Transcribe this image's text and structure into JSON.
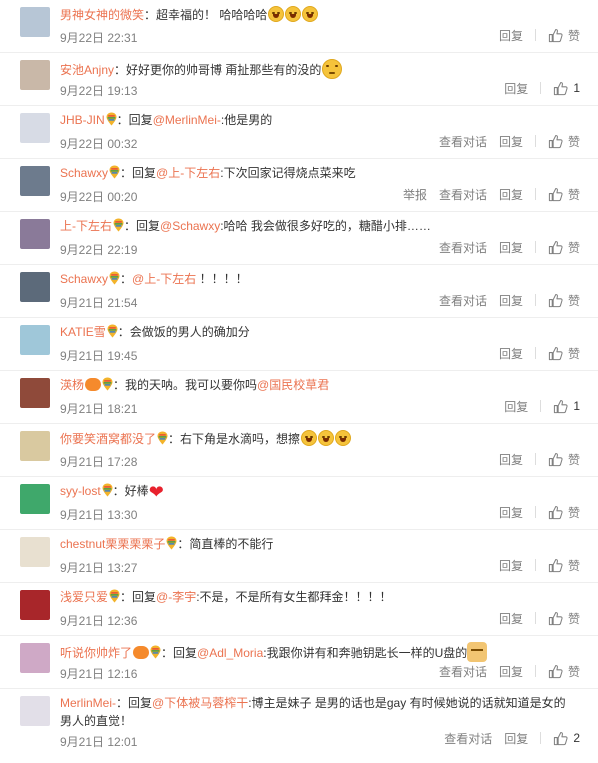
{
  "labels": {
    "reply": "回复",
    "view_dialog": "查看对话",
    "report": "举报",
    "like": "赞"
  },
  "comments": [
    {
      "user": "男神女神的微笑",
      "segments": [
        {
          "t": "：超幸福的！ 哈哈哈哈",
          "k": "txt"
        }
      ],
      "emojis": 3,
      "time": "9月22日 22:31",
      "dialog": false,
      "report": false,
      "likes": ""
    },
    {
      "user": "安池Anjny",
      "segments": [
        {
          "t": "：好好更你的帅哥博 甭扯那些有的没的",
          "k": "txt"
        }
      ],
      "emojis": 1,
      "big_emoji": true,
      "time": "9月22日 19:13",
      "dialog": false,
      "report": false,
      "likes": "1"
    },
    {
      "user": "JHB-JIN",
      "badge": true,
      "segments": [
        {
          "t": "：回复",
          "k": "txt"
        },
        {
          "t": "@MerlinMei-",
          "k": "mention"
        },
        {
          "t": ":他是男的",
          "k": "txt"
        }
      ],
      "time": "9月22日 00:32",
      "dialog": true,
      "report": false,
      "likes": ""
    },
    {
      "user": "Schawxy",
      "badge": true,
      "segments": [
        {
          "t": "：回复",
          "k": "txt"
        },
        {
          "t": "@上-下左右",
          "k": "mention"
        },
        {
          "t": ":下次回家记得烧点菜来吃",
          "k": "txt"
        }
      ],
      "time": "9月22日 00:20",
      "dialog": true,
      "report": true,
      "likes": ""
    },
    {
      "user": "上-下左右",
      "badge": true,
      "segments": [
        {
          "t": "：回复",
          "k": "txt"
        },
        {
          "t": "@Schawxy",
          "k": "mention"
        },
        {
          "t": ":哈哈  我会做很多好吃的，糖醋小排……",
          "k": "txt"
        }
      ],
      "time": "9月22日 22:19",
      "dialog": true,
      "report": false,
      "likes": ""
    },
    {
      "user": "Schawxy",
      "badge": true,
      "segments": [
        {
          "t": "：",
          "k": "txt"
        },
        {
          "t": "@上-下左右",
          "k": "mention"
        },
        {
          "t": " ！！！！",
          "k": "txt"
        }
      ],
      "time": "9月21日 21:54",
      "dialog": true,
      "report": false,
      "likes": ""
    },
    {
      "user": "KATIE雪",
      "badge": true,
      "segments": [
        {
          "t": "：会做饭的男人的确加分",
          "k": "txt"
        }
      ],
      "time": "9月21日 19:45",
      "dialog": false,
      "report": false,
      "likes": ""
    },
    {
      "user": "渶杨",
      "vip": true,
      "badge": true,
      "segments": [
        {
          "t": "：我的天呐。我可以要你吗",
          "k": "txt"
        },
        {
          "t": "@国民校草君",
          "k": "mention"
        }
      ],
      "time": "9月21日 18:21",
      "dialog": false,
      "report": false,
      "likes": "1"
    },
    {
      "user": "你要笑酒窝都没了",
      "badge": true,
      "segments": [
        {
          "t": "：右下角是水滴吗，想擦",
          "k": "txt"
        }
      ],
      "emojis": 3,
      "time": "9月21日 17:28",
      "dialog": false,
      "report": false,
      "likes": ""
    },
    {
      "user": "syy-lost",
      "badge": true,
      "segments": [
        {
          "t": "：好棒",
          "k": "txt"
        }
      ],
      "heart": "❤",
      "time": "9月21日 13:30",
      "dialog": false,
      "report": false,
      "likes": ""
    },
    {
      "user": "chestnut栗栗栗栗子",
      "badge": true,
      "segments": [
        {
          "t": "：简直棒的不能行",
          "k": "txt"
        }
      ],
      "time": "9月21日 13:27",
      "dialog": false,
      "report": false,
      "likes": ""
    },
    {
      "user": "浅爱只爱",
      "badge": true,
      "segments": [
        {
          "t": "：回复",
          "k": "txt"
        },
        {
          "t": "@-李宇",
          "k": "mention"
        },
        {
          "t": ":不是，不是所有女生都拜金！！！！",
          "k": "txt"
        }
      ],
      "time": "9月21日 12:36",
      "dialog": false,
      "report": false,
      "likes": ""
    },
    {
      "user": "听说你帅炸了",
      "vip": true,
      "badge": true,
      "segments": [
        {
          "t": "：回复",
          "k": "txt"
        },
        {
          "t": "@Adl_Moria",
          "k": "mention"
        },
        {
          "t": ":我跟你讲有和奔驰钥匙长一样的U盘的",
          "k": "txt"
        }
      ],
      "dog": true,
      "time": "9月21日 12:16",
      "dialog": true,
      "report": false,
      "likes": ""
    },
    {
      "user": "MerlinMei-",
      "segments": [
        {
          "t": "：回复",
          "k": "txt"
        },
        {
          "t": "@下体被马蓉榨干",
          "k": "mention"
        },
        {
          "t": ":博主是妹子 是男的话也是gay 有时候她说的话就知道是女的 男人的直觉！",
          "k": "txt"
        }
      ],
      "time": "9月21日 12:01",
      "dialog": true,
      "report": false,
      "likes": "2"
    }
  ],
  "avatar_colors": [
    "#b7c6d6",
    "#c9b8a8",
    "#d7dbe5",
    "#6d7b8d",
    "#8a7a99",
    "#5c6a7a",
    "#9fc7d9",
    "#8f4a3a",
    "#d9c9a0",
    "#3fa86b",
    "#e8e0d0",
    "#a8262a",
    "#cfa9c6",
    "#e2dfe8"
  ]
}
